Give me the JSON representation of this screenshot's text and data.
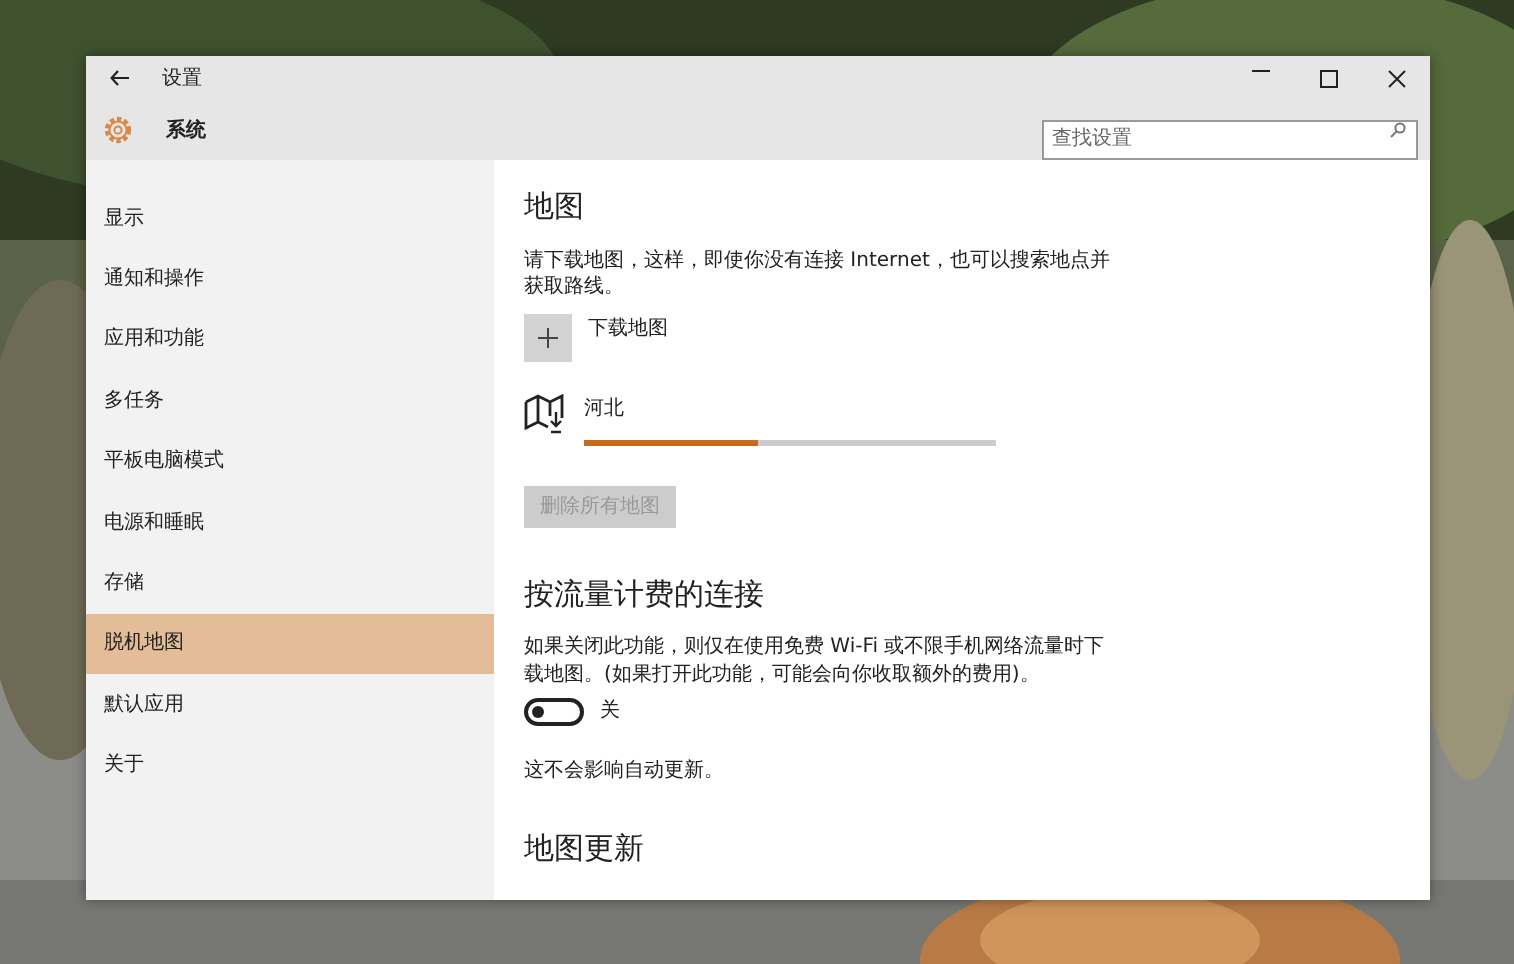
{
  "window": {
    "title": "设置"
  },
  "header": {
    "title": "系统",
    "search": {
      "placeholder": "查找设置"
    }
  },
  "sidebar": {
    "items": [
      {
        "label": "显示",
        "selected": false
      },
      {
        "label": "通知和操作",
        "selected": false
      },
      {
        "label": "应用和功能",
        "selected": false
      },
      {
        "label": "多任务",
        "selected": false
      },
      {
        "label": "平板电脑模式",
        "selected": false
      },
      {
        "label": "电源和睡眠",
        "selected": false
      },
      {
        "label": "存储",
        "selected": false
      },
      {
        "label": "脱机地图",
        "selected": true
      },
      {
        "label": "默认应用",
        "selected": false
      },
      {
        "label": "关于",
        "selected": false
      }
    ]
  },
  "maps": {
    "heading": "地图",
    "description": "请下载地图，这样，即使你没有连接 Internet，也可以搜索地点并获取路线。",
    "add_button": {
      "label": "下载地图"
    },
    "downloads": [
      {
        "name": "河北",
        "level": 0.42
      }
    ],
    "delete_button": {
      "label": "删除所有地图",
      "disabled": true
    }
  },
  "metered": {
    "heading": "按流量计费的连接",
    "description": "如果关闭此功能，则仅在使用免费 Wi-Fi 或不限手机网络流量时下载地图。(如果打开此功能，可能会向你收取额外的费用)。",
    "toggle": {
      "on": false,
      "label": "关"
    },
    "note": "这不会影响自动更新。"
  },
  "updates": {
    "heading": "地图更新"
  }
}
